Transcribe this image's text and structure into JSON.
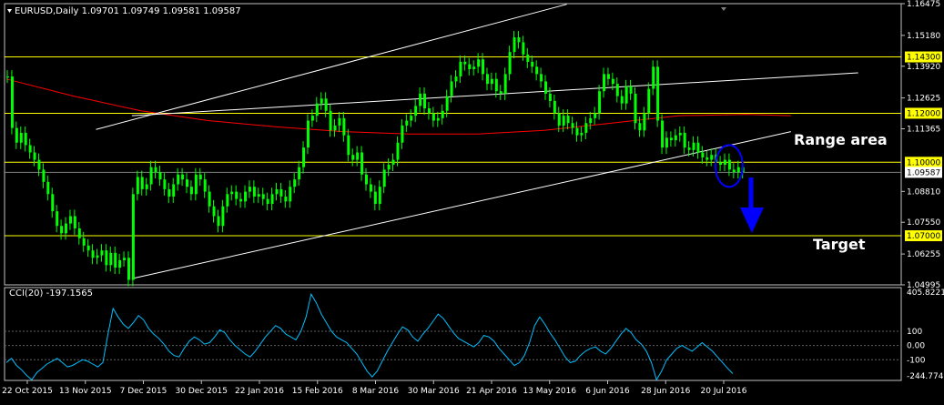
{
  "header": {
    "symbol_line": "EURUSD,Daily  1.09701 1.09749 1.09581 1.09587"
  },
  "indicator": {
    "title": "CCI(20) -197.1565",
    "axis_labels": [
      "405.8221",
      "100",
      "0.00",
      "-100",
      "-244.7742"
    ]
  },
  "annotations": {
    "range": "Range area",
    "target": "Target"
  },
  "colors": {
    "background": "#000000",
    "candle": "#00ff00",
    "support_resistance": "#ffff00",
    "channel": "#ffffff",
    "moving_average": "#ff0000",
    "cci_line": "#00bfff",
    "circle": "#0000ff",
    "arrow": "#0000ff",
    "frame": "#c0c0c0"
  },
  "chart_data": [
    {
      "type": "candlestick",
      "title": "EURUSD,Daily",
      "ohlc_last": {
        "open": 1.09701,
        "high": 1.09749,
        "low": 1.09581,
        "close": 1.09587
      },
      "x_tick_labels": [
        "22 Oct 2015",
        "13 Nov 2015",
        "7 Dec 2015",
        "30 Dec 2015",
        "22 Jan 2016",
        "15 Feb 2016",
        "8 Mar 2016",
        "30 Mar 2016",
        "21 Apr 2016",
        "13 May 2016",
        "6 Jun 2016",
        "28 Jun 2016",
        "20 Jul 2016"
      ],
      "y_tick_labels": [
        "1.16475",
        "1.15180",
        "1.13920",
        "1.12625",
        "1.11365",
        "1.08810",
        "1.07550",
        "1.06255",
        "1.04995"
      ],
      "ylim": [
        1.04995,
        1.16475
      ],
      "horizontal_levels": [
        {
          "label": "1.14300",
          "value": 1.143
        },
        {
          "label": "1.12000",
          "value": 1.12
        },
        {
          "label": "1.10000",
          "value": 1.1
        },
        {
          "label": "1.07000",
          "value": 1.07
        }
      ],
      "current_price": {
        "label": "1.09587",
        "value": 1.09587
      },
      "moving_average_approx": [
        [
          0,
          1.134
        ],
        [
          15,
          1.127
        ],
        [
          30,
          1.121
        ],
        [
          45,
          1.117
        ],
        [
          60,
          1.1145
        ],
        [
          75,
          1.1125
        ],
        [
          90,
          1.1115
        ],
        [
          105,
          1.1115
        ],
        [
          120,
          1.113
        ],
        [
          135,
          1.116
        ],
        [
          150,
          1.119
        ],
        [
          165,
          1.1195
        ],
        [
          175,
          1.119
        ]
      ],
      "channel_lines": [
        {
          "name": "upper",
          "points": [
            [
              20,
              1.1134
            ],
            [
              125,
              1.1645
            ]
          ]
        },
        {
          "name": "middle",
          "points": [
            [
              28,
              1.119
            ],
            [
              190,
              1.1365
            ]
          ]
        },
        {
          "name": "lower",
          "points": [
            [
              28,
              1.0525
            ],
            [
              175,
              1.1125
            ]
          ]
        }
      ],
      "bars_approx_close": [
        1.135,
        1.114,
        1.108,
        1.112,
        1.107,
        1.104,
        1.101,
        1.097,
        1.092,
        1.087,
        1.08,
        1.074,
        1.071,
        1.075,
        1.078,
        1.073,
        1.069,
        1.066,
        1.064,
        1.061,
        1.062,
        1.064,
        1.058,
        1.063,
        1.057,
        1.06,
        1.061,
        1.052,
        1.087,
        1.094,
        1.089,
        1.091,
        1.098,
        1.096,
        1.093,
        1.089,
        1.086,
        1.091,
        1.095,
        1.093,
        1.09,
        1.087,
        1.095,
        1.093,
        1.088,
        1.082,
        1.078,
        1.074,
        1.082,
        1.087,
        1.088,
        1.085,
        1.084,
        1.088,
        1.09,
        1.086,
        1.087,
        1.085,
        1.083,
        1.087,
        1.089,
        1.086,
        1.084,
        1.09,
        1.093,
        1.098,
        1.106,
        1.117,
        1.119,
        1.124,
        1.126,
        1.121,
        1.113,
        1.115,
        1.118,
        1.111,
        1.103,
        1.101,
        1.104,
        1.095,
        1.091,
        1.088,
        1.083,
        1.09,
        1.097,
        1.099,
        1.101,
        1.108,
        1.115,
        1.117,
        1.119,
        1.123,
        1.128,
        1.122,
        1.12,
        1.117,
        1.118,
        1.121,
        1.127,
        1.133,
        1.135,
        1.141,
        1.14,
        1.138,
        1.139,
        1.142,
        1.136,
        1.132,
        1.134,
        1.129,
        1.128,
        1.136,
        1.145,
        1.151,
        1.149,
        1.144,
        1.141,
        1.139,
        1.136,
        1.133,
        1.128,
        1.125,
        1.12,
        1.115,
        1.119,
        1.116,
        1.114,
        1.111,
        1.112,
        1.116,
        1.118,
        1.12,
        1.129,
        1.136,
        1.134,
        1.132,
        1.127,
        1.124,
        1.131,
        1.128,
        1.116,
        1.113,
        1.12,
        1.13,
        1.139,
        1.117,
        1.106,
        1.11,
        1.109,
        1.111,
        1.112,
        1.106,
        1.105,
        1.108,
        1.104,
        1.102,
        1.101,
        1.103,
        1.1,
        1.099,
        1.101,
        1.097,
        1.096,
        1.098,
        1.096
      ],
      "xlim_bars": [
        0,
        200
      ]
    },
    {
      "type": "line",
      "title": "CCI(20)",
      "series": [
        {
          "name": "CCI(20)",
          "values": [
            -120,
            -90,
            -140,
            -170,
            -210,
            -240,
            -190,
            -160,
            -130,
            -110,
            -90,
            -120,
            -150,
            -140,
            -120,
            -100,
            -110,
            -130,
            -150,
            -120,
            80,
            260,
            200,
            150,
            120,
            160,
            210,
            180,
            120,
            80,
            50,
            10,
            -40,
            -70,
            -80,
            -20,
            30,
            60,
            40,
            10,
            20,
            60,
            110,
            90,
            40,
            0,
            -30,
            -60,
            -80,
            -40,
            10,
            60,
            100,
            140,
            120,
            80,
            60,
            40,
            100,
            200,
            360,
            300,
            220,
            160,
            100,
            60,
            40,
            20,
            -20,
            -60,
            -120,
            -180,
            -220,
            -180,
            -110,
            -40,
            20,
            80,
            130,
            110,
            60,
            30,
            80,
            120,
            170,
            220,
            190,
            140,
            90,
            50,
            30,
            10,
            -10,
            20,
            70,
            60,
            30,
            -20,
            -60,
            -100,
            -140,
            -120,
            -70,
            20,
            140,
            200,
            150,
            90,
            40,
            -20,
            -80,
            -120,
            -110,
            -70,
            -40,
            -20,
            -10,
            -40,
            -60,
            -20,
            30,
            80,
            120,
            90,
            40,
            10,
            -40,
            -120,
            -240,
            -180,
            -100,
            -60,
            -20,
            0,
            -20,
            -40,
            -10,
            20,
            -10,
            -40,
            -80,
            -120,
            -160,
            -197
          ]
        }
      ],
      "ylim": [
        -244.7742,
        405.8221
      ],
      "reference_lines": [
        100,
        0,
        -100
      ]
    }
  ]
}
